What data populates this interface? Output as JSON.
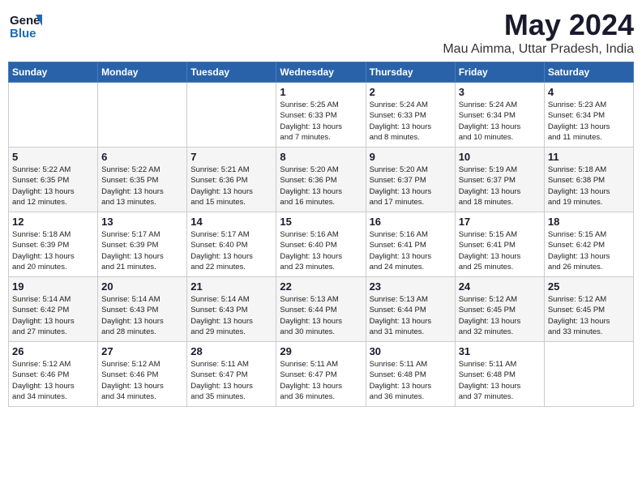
{
  "header": {
    "logo_general": "General",
    "logo_blue": "Blue",
    "title": "May 2024",
    "subtitle": "Mau Aimma, Uttar Pradesh, India"
  },
  "weekdays": [
    "Sunday",
    "Monday",
    "Tuesday",
    "Wednesday",
    "Thursday",
    "Friday",
    "Saturday"
  ],
  "weeks": [
    {
      "cells": [
        {
          "empty": true
        },
        {
          "empty": true
        },
        {
          "empty": true
        },
        {
          "day": 1,
          "sunrise": "5:25 AM",
          "sunset": "6:33 PM",
          "daylight": "13 hours and 7 minutes."
        },
        {
          "day": 2,
          "sunrise": "5:24 AM",
          "sunset": "6:33 PM",
          "daylight": "13 hours and 8 minutes."
        },
        {
          "day": 3,
          "sunrise": "5:24 AM",
          "sunset": "6:34 PM",
          "daylight": "13 hours and 10 minutes."
        },
        {
          "day": 4,
          "sunrise": "5:23 AM",
          "sunset": "6:34 PM",
          "daylight": "13 hours and 11 minutes."
        }
      ]
    },
    {
      "cells": [
        {
          "day": 5,
          "sunrise": "5:22 AM",
          "sunset": "6:35 PM",
          "daylight": "13 hours and 12 minutes."
        },
        {
          "day": 6,
          "sunrise": "5:22 AM",
          "sunset": "6:35 PM",
          "daylight": "13 hours and 13 minutes."
        },
        {
          "day": 7,
          "sunrise": "5:21 AM",
          "sunset": "6:36 PM",
          "daylight": "13 hours and 15 minutes."
        },
        {
          "day": 8,
          "sunrise": "5:20 AM",
          "sunset": "6:36 PM",
          "daylight": "13 hours and 16 minutes."
        },
        {
          "day": 9,
          "sunrise": "5:20 AM",
          "sunset": "6:37 PM",
          "daylight": "13 hours and 17 minutes."
        },
        {
          "day": 10,
          "sunrise": "5:19 AM",
          "sunset": "6:37 PM",
          "daylight": "13 hours and 18 minutes."
        },
        {
          "day": 11,
          "sunrise": "5:18 AM",
          "sunset": "6:38 PM",
          "daylight": "13 hours and 19 minutes."
        }
      ]
    },
    {
      "cells": [
        {
          "day": 12,
          "sunrise": "5:18 AM",
          "sunset": "6:39 PM",
          "daylight": "13 hours and 20 minutes."
        },
        {
          "day": 13,
          "sunrise": "5:17 AM",
          "sunset": "6:39 PM",
          "daylight": "13 hours and 21 minutes."
        },
        {
          "day": 14,
          "sunrise": "5:17 AM",
          "sunset": "6:40 PM",
          "daylight": "13 hours and 22 minutes."
        },
        {
          "day": 15,
          "sunrise": "5:16 AM",
          "sunset": "6:40 PM",
          "daylight": "13 hours and 23 minutes."
        },
        {
          "day": 16,
          "sunrise": "5:16 AM",
          "sunset": "6:41 PM",
          "daylight": "13 hours and 24 minutes."
        },
        {
          "day": 17,
          "sunrise": "5:15 AM",
          "sunset": "6:41 PM",
          "daylight": "13 hours and 25 minutes."
        },
        {
          "day": 18,
          "sunrise": "5:15 AM",
          "sunset": "6:42 PM",
          "daylight": "13 hours and 26 minutes."
        }
      ]
    },
    {
      "cells": [
        {
          "day": 19,
          "sunrise": "5:14 AM",
          "sunset": "6:42 PM",
          "daylight": "13 hours and 27 minutes."
        },
        {
          "day": 20,
          "sunrise": "5:14 AM",
          "sunset": "6:43 PM",
          "daylight": "13 hours and 28 minutes."
        },
        {
          "day": 21,
          "sunrise": "5:14 AM",
          "sunset": "6:43 PM",
          "daylight": "13 hours and 29 minutes."
        },
        {
          "day": 22,
          "sunrise": "5:13 AM",
          "sunset": "6:44 PM",
          "daylight": "13 hours and 30 minutes."
        },
        {
          "day": 23,
          "sunrise": "5:13 AM",
          "sunset": "6:44 PM",
          "daylight": "13 hours and 31 minutes."
        },
        {
          "day": 24,
          "sunrise": "5:12 AM",
          "sunset": "6:45 PM",
          "daylight": "13 hours and 32 minutes."
        },
        {
          "day": 25,
          "sunrise": "5:12 AM",
          "sunset": "6:45 PM",
          "daylight": "13 hours and 33 minutes."
        }
      ]
    },
    {
      "cells": [
        {
          "day": 26,
          "sunrise": "5:12 AM",
          "sunset": "6:46 PM",
          "daylight": "13 hours and 34 minutes."
        },
        {
          "day": 27,
          "sunrise": "5:12 AM",
          "sunset": "6:46 PM",
          "daylight": "13 hours and 34 minutes."
        },
        {
          "day": 28,
          "sunrise": "5:11 AM",
          "sunset": "6:47 PM",
          "daylight": "13 hours and 35 minutes."
        },
        {
          "day": 29,
          "sunrise": "5:11 AM",
          "sunset": "6:47 PM",
          "daylight": "13 hours and 36 minutes."
        },
        {
          "day": 30,
          "sunrise": "5:11 AM",
          "sunset": "6:48 PM",
          "daylight": "13 hours and 36 minutes."
        },
        {
          "day": 31,
          "sunrise": "5:11 AM",
          "sunset": "6:48 PM",
          "daylight": "13 hours and 37 minutes."
        },
        {
          "empty": true
        }
      ]
    }
  ],
  "daylight_label": "Daylight:",
  "sunrise_label": "Sunrise:",
  "sunset_label": "Sunset:"
}
